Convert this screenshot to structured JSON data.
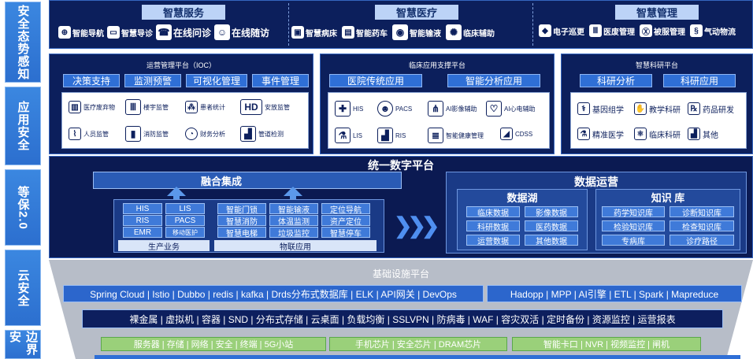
{
  "left_bar": [
    "安全态势感知",
    "应用安全",
    "等保2.0",
    "云安全",
    "边界安"
  ],
  "top": {
    "sections": [
      "智慧服务",
      "智慧医疗",
      "智慧管理"
    ],
    "service_items": [
      "智能导航",
      "智慧导诊",
      "在线问诊",
      "在线随访"
    ],
    "medical_items": [
      "智慧病床",
      "智能药车",
      "智能输液",
      "临床辅助"
    ],
    "management_items": [
      "电子巡更",
      "医废管理",
      "被服管理",
      "气动物流"
    ]
  },
  "ioc": {
    "title": "运营管理平台（IOC）",
    "buttons": [
      "决策支持",
      "监测预警",
      "可视化管理",
      "事件管理"
    ],
    "items": [
      "医疗废弃物",
      "楼宇监管",
      "患者统计",
      "安放监管",
      "人员监管",
      "消防监管",
      "财务分析",
      "管道检测"
    ],
    "item_icons": [
      "bin-icon",
      "building-icon",
      "people-icon",
      "hd-icon",
      "pulse-icon",
      "extinguisher-icon",
      "chart-circle-icon",
      "bar-chart-icon"
    ]
  },
  "clinical": {
    "title": "临床应用支撑平台",
    "buttons": [
      "医院传统应用",
      "智能分析应用"
    ],
    "items": [
      "HIS",
      "PACS",
      "AI影像辅助",
      "AI心电辅助",
      "LIS",
      "RIS",
      "智能健康管理",
      "CDSS"
    ]
  },
  "research": {
    "title": "智慧科研平台",
    "buttons": [
      "科研分析",
      "科研应用"
    ],
    "items": [
      "基因组学",
      "教学科研",
      "药品研发",
      "精准医学",
      "临床科研",
      "其他"
    ]
  },
  "unified": {
    "title": "统一数字平台",
    "fusion": "融合集成",
    "production_cells": [
      "HIS",
      "LIS",
      "RIS",
      "PACS",
      "EMR",
      "移动医护"
    ],
    "production_label": "生产业务",
    "iot_cells": [
      "智能门锁",
      "智能输液",
      "定位导航",
      "智慧消防",
      "体温监测",
      "资产定位",
      "智慧电梯",
      "垃圾监控",
      "智慧停车"
    ],
    "iot_label": "物联应用",
    "data_ops": "数据运营",
    "data_lake": "数据湖",
    "data_lake_cells": [
      "临床数据",
      "影像数据",
      "科研数据",
      "医药数据",
      "运营数据",
      "其他数据"
    ],
    "knowledge": "知识 库",
    "knowledge_cells": [
      "药学知识库",
      "诊断知识库",
      "检验知识库",
      "检查知识库",
      "专病库",
      "诊疗路径"
    ]
  },
  "infra": {
    "title": "基础设施平台",
    "row1_left": "Spring Cloud | Istio | Dubbo | redis | kafka | Drds分布式数据库 | ELK | API网关 | DevOps",
    "row1_right": "Hadopp | MPP | AI引擎 | ETL | Spark | Mapreduce",
    "row2": "裸金属 | 虚拟机 | 容器 | SND | 分布式存储 | 云桌面 | 负载均衡 | SSLVPN | 防病毒 | WAF | 容灾双活 | 定时备份 | 资源监控 | 运营报表",
    "row3": [
      "服务器 | 存储 | 网络 | 安全 | 终端 | 5G小站",
      "手机芯片 | 安全芯片 | DRAM芯片",
      "智能卡口 | NVR | 视频监控 | 闸机"
    ]
  },
  "colors": {
    "dark": "#0c1f5c",
    "accent": "#2f6fd6",
    "header": "#bcd3f7",
    "green": "#9ad07a"
  }
}
